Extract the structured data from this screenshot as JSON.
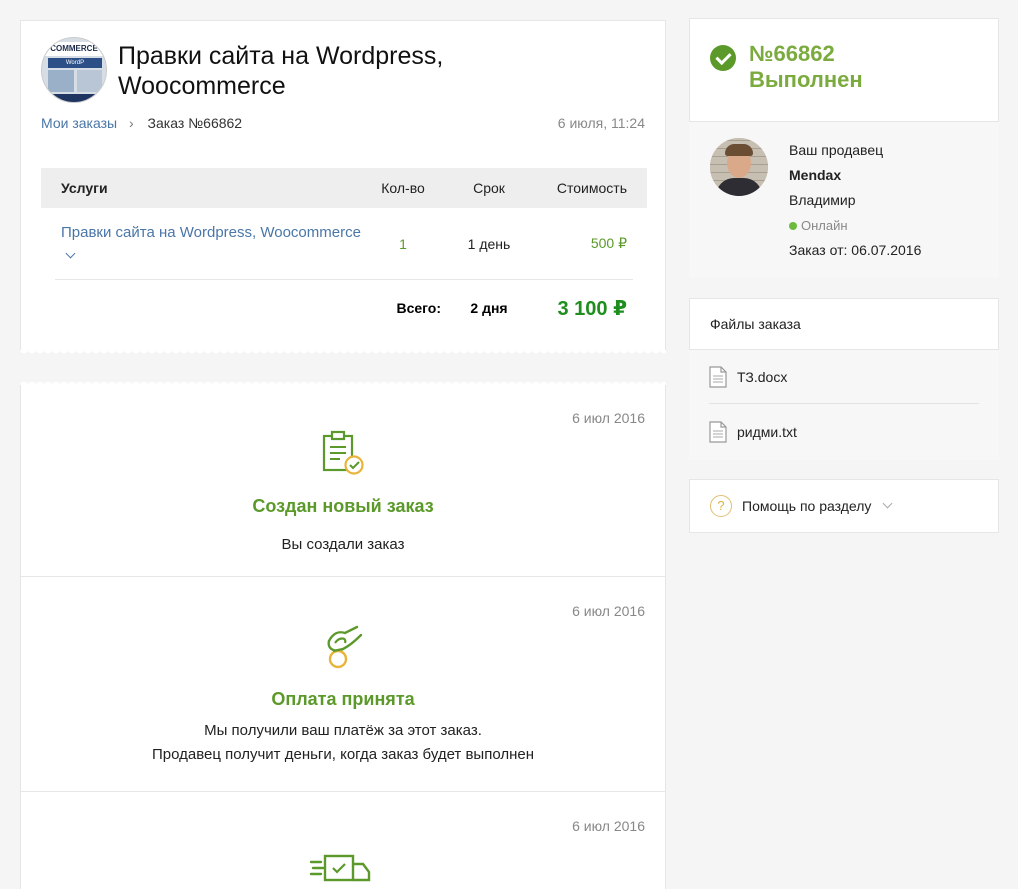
{
  "order": {
    "title": "Правки сайта на Wordpress, Woocommerce",
    "thumb_label": "COMMERCE",
    "thumb_sub": "WordP",
    "breadcrumb_link": "Мои заказы",
    "breadcrumb_current": "Заказ №66862",
    "date": "6 июля, 11:24"
  },
  "table": {
    "headers": {
      "service": "Услуги",
      "qty": "Кол-во",
      "term": "Срок",
      "cost": "Стоимость"
    },
    "row": {
      "service": "Правки сайта на Wordpress, Woocommerce",
      "qty": "1",
      "term": "1 день",
      "cost": "500 ₽"
    },
    "total": {
      "label": "Всего:",
      "term": "2 дня",
      "cost": "3 100 ₽"
    }
  },
  "timeline": [
    {
      "date": "6 июл 2016",
      "title": "Создан новый заказ",
      "text": [
        "Вы создали заказ"
      ],
      "icon": "clipboard-check-icon"
    },
    {
      "date": "6 июл 2016",
      "title": "Оплата принята",
      "text": [
        "Мы получили ваш платёж за этот заказ.",
        "Продавец получит деньги, когда заказ будет выполнен"
      ],
      "icon": "hand-coin-icon"
    },
    {
      "date": "6 июл 2016",
      "title": "",
      "text": [],
      "icon": "delivery-truck-icon"
    }
  ],
  "status": {
    "number": "№66862",
    "label": "Выполнен"
  },
  "seller": {
    "caption": "Ваш продавец",
    "nick": "Mendax",
    "name": "Владимир",
    "status": "Онлайн",
    "order_from": "Заказ от: 06.07.2016"
  },
  "files": {
    "title": "Файлы заказа",
    "items": [
      "ТЗ.docx",
      "ридми.txt"
    ]
  },
  "help": {
    "label": "Помощь по разделу"
  },
  "colors": {
    "green": "#5b9a2a",
    "link": "#4a76a8",
    "total": "#1e8e1e",
    "accent_yellow": "#e8b43a"
  }
}
